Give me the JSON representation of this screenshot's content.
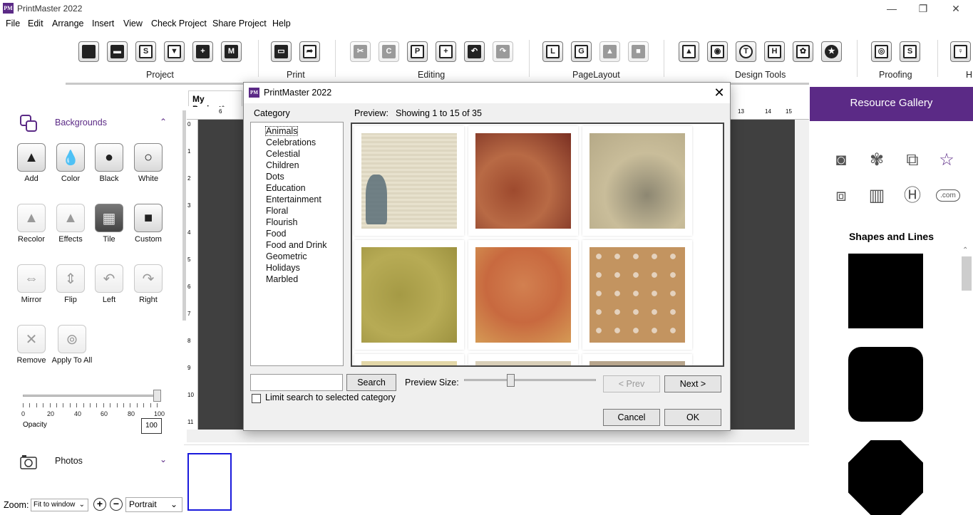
{
  "window": {
    "title": "PrintMaster 2022",
    "logo_small": "PM",
    "minimize": "—",
    "restore": "❐",
    "close": "✕"
  },
  "menu": [
    "File",
    "Edit",
    "Arrange",
    "Insert",
    "View",
    "Check Project",
    "Share Project",
    "Help"
  ],
  "ribbon": {
    "logo": "PM",
    "groups": {
      "project": "Project",
      "print": "Print",
      "editing": "Editing",
      "page_layout": "PageLayout",
      "design_tools": "Design Tools",
      "proofing": "Proofing",
      "help": "H"
    }
  },
  "left_panel": {
    "backgrounds_title": "Backgrounds",
    "tools": [
      "Add",
      "Color",
      "Black",
      "White",
      "Recolor",
      "Effects",
      "Tile",
      "Custom",
      "Mirror",
      "Flip",
      "Left",
      "Right",
      "Remove",
      "Apply To All"
    ],
    "opacity": {
      "label": "Opacity",
      "value": "100",
      "level": 1.0,
      "ticks": [
        "0",
        "20",
        "40",
        "60",
        "80",
        "100"
      ]
    },
    "photos_title": "Photos"
  },
  "bottom_bar": {
    "zoom_label": "Zoom:",
    "zoom_value": "Fit to window",
    "orientation": "Portrait"
  },
  "document": {
    "tab": "My Project*",
    "ruler_top": [
      "6",
      "13",
      "14",
      "15"
    ],
    "ruler_left": [
      "0",
      "1",
      "2",
      "3",
      "4",
      "5",
      "6",
      "7",
      "8",
      "9",
      "10",
      "11"
    ]
  },
  "resource_gallery": {
    "title": "Resource Gallery",
    "shapes_title": "Shapes and Lines",
    "com_label": ".com"
  },
  "dialog": {
    "title": "PrintMaster 2022",
    "category_label": "Category",
    "categories": [
      "Animals",
      "Celebrations",
      "Celestial",
      "Children",
      "Dots",
      "Education",
      "Entertainment",
      "Floral",
      "Flourish",
      "Food",
      "Food and Drink",
      "Geometric",
      "Holidays",
      "Marbled"
    ],
    "selected_category": "Animals",
    "preview_label": "Preview:",
    "preview_count": "Showing 1 to 15 of 35",
    "search_button": "Search",
    "search_value": "",
    "limit_label": "Limit search to selected category",
    "preview_size_label": "Preview Size:",
    "preview_size_level": 0.35,
    "prev_button": "< Prev",
    "next_button": "Next >",
    "cancel_button": "Cancel",
    "ok_button": "OK",
    "close": "✕"
  },
  "colors": {
    "brand": "#5b2a86",
    "canvas": "#404040"
  }
}
